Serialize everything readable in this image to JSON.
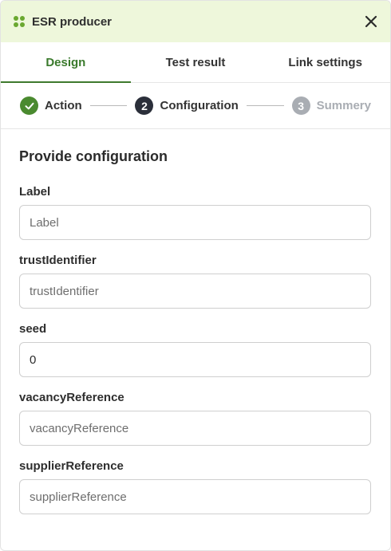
{
  "header": {
    "title": "ESR producer",
    "app_icon": "app-grid-icon",
    "close_icon": "close-icon",
    "bg_color": "#eef7db",
    "icon_color": "#6aa830"
  },
  "tabs": [
    {
      "label": "Design",
      "active": true
    },
    {
      "label": "Test result",
      "active": false
    },
    {
      "label": "Link settings",
      "active": false
    }
  ],
  "stepper": {
    "steps": [
      {
        "number": "",
        "label": "Action",
        "state": "done"
      },
      {
        "number": "2",
        "label": "Configuration",
        "state": "current"
      },
      {
        "number": "3",
        "label": "Summery",
        "state": "pending"
      }
    ]
  },
  "form": {
    "title": "Provide configuration",
    "fields": [
      {
        "label": "Label",
        "value": "",
        "placeholder": "Label"
      },
      {
        "label": "trustIdentifier",
        "value": "",
        "placeholder": "trustIdentifier"
      },
      {
        "label": "seed",
        "value": "0",
        "placeholder": ""
      },
      {
        "label": "vacancyReference",
        "value": "",
        "placeholder": "vacancyReference"
      },
      {
        "label": "supplierReference",
        "value": "",
        "placeholder": "supplierReference"
      }
    ]
  },
  "colors": {
    "accent": "#3a7a2c",
    "step_done": "#4a8a2f",
    "step_current": "#2b2f3a",
    "step_pending": "#a9adb3"
  }
}
